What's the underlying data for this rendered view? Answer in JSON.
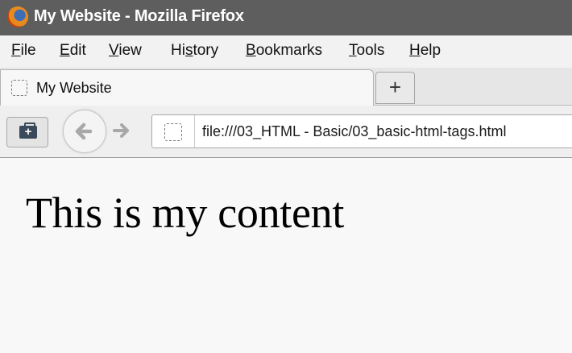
{
  "window": {
    "title": "My Website - Mozilla Firefox"
  },
  "menu": {
    "items": [
      {
        "label": "File",
        "accesskey": "F",
        "rest": "ile"
      },
      {
        "label": "Edit",
        "accesskey": "E",
        "rest": "dit"
      },
      {
        "label": "View",
        "accesskey": "V",
        "rest": "iew"
      },
      {
        "label": "History",
        "pre": "Hi",
        "accesskey": "s",
        "rest": "tory"
      },
      {
        "label": "Bookmarks",
        "accesskey": "B",
        "rest": "ookmarks"
      },
      {
        "label": "Tools",
        "accesskey": "T",
        "rest": "ools"
      },
      {
        "label": "Help",
        "accesskey": "H",
        "rest": "elp"
      }
    ]
  },
  "tab": {
    "label": "My Website",
    "new_tab_symbol": "+"
  },
  "navbar": {
    "url": "file:///03_HTML - Basic/03_basic-html-tags.html",
    "home_icon": "home-plus-icon",
    "back_icon": "back-arrow-icon",
    "forward_icon": "forward-arrow-icon"
  },
  "page": {
    "heading": "This is my content"
  },
  "colors": {
    "titlebar": "#5e5e5e",
    "menubar": "#f2f2f2",
    "content_bg": "#f8f8f8"
  }
}
